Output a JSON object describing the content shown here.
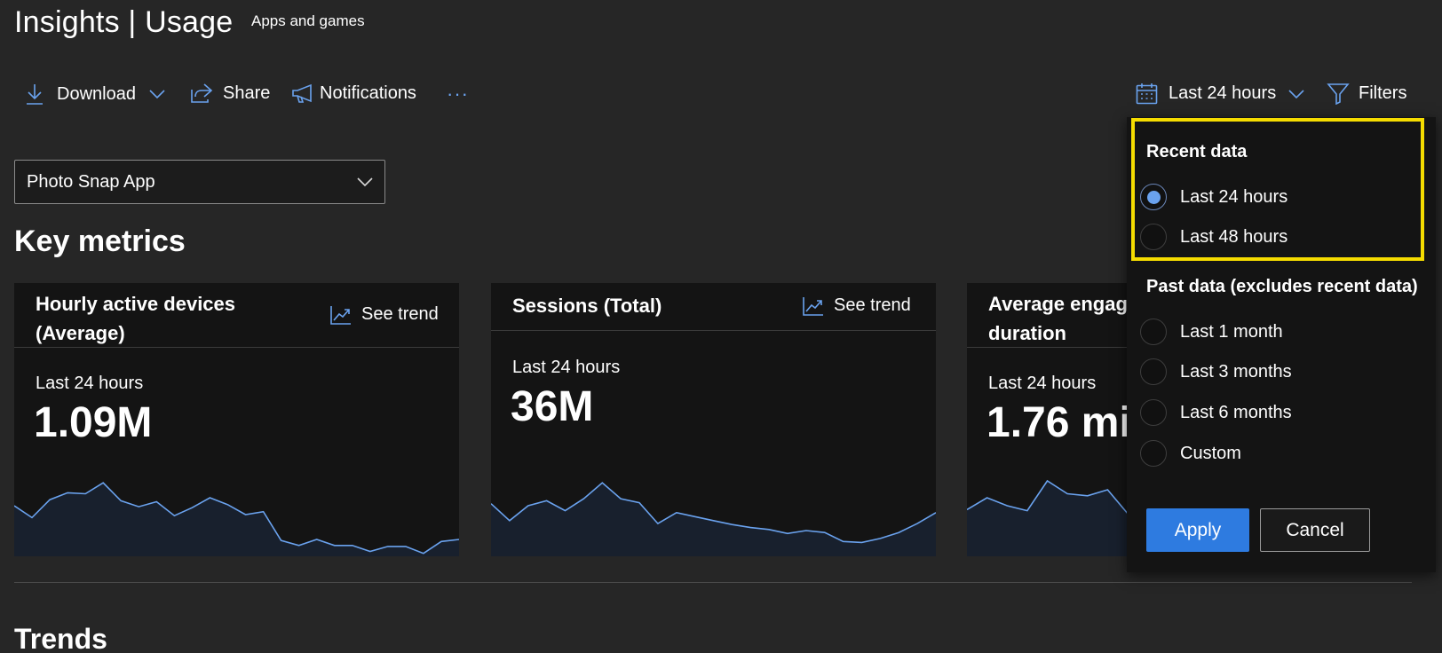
{
  "header": {
    "title": "Insights | Usage",
    "subtitle": "Apps and games"
  },
  "toolbar": {
    "download_label": "Download",
    "share_label": "Share",
    "notifications_label": "Notifications",
    "more_label": "···",
    "date_range_label": "Last 24 hours",
    "filters_label": "Filters"
  },
  "app_selector": {
    "selected": "Photo Snap App"
  },
  "key_metrics": {
    "heading": "Key metrics",
    "see_trend_label": "See trend",
    "cards": [
      {
        "title_line1": "Hourly active devices",
        "title_line2": "(Average)",
        "period": "Last 24 hours",
        "value": "1.09M",
        "sparkline": [
          0.58,
          0.7,
          0.52,
          0.45,
          0.46,
          0.35,
          0.53,
          0.59,
          0.54,
          0.68,
          0.6,
          0.5,
          0.57,
          0.67,
          0.64,
          0.93,
          0.98,
          0.92,
          0.98,
          0.98,
          1.04,
          0.99,
          0.99,
          1.06,
          0.94,
          0.92
        ]
      },
      {
        "title": "Sessions (Total)",
        "period": "Last 24 hours",
        "value": "36M",
        "sparkline": [
          0.56,
          0.73,
          0.58,
          0.53,
          0.63,
          0.51,
          0.35,
          0.51,
          0.55,
          0.76,
          0.65,
          0.69,
          0.73,
          0.77,
          0.8,
          0.82,
          0.86,
          0.83,
          0.85,
          0.94,
          0.95,
          0.91,
          0.85,
          0.76,
          0.65
        ]
      },
      {
        "title_line1": "Average engag",
        "title_line2": "duration",
        "period": "Last 24 hours",
        "value": "1.76 mi",
        "sparkline": [
          0.62,
          0.5,
          0.58,
          0.63,
          0.33,
          0.46,
          0.48,
          0.42,
          0.66
        ]
      }
    ]
  },
  "date_panel": {
    "recent_heading": "Recent data",
    "recent_options": [
      {
        "label": "Last 24 hours",
        "selected": true
      },
      {
        "label": "Last 48 hours",
        "selected": false
      }
    ],
    "past_heading": "Past data (excludes recent data)",
    "past_options": [
      {
        "label": "Last 1 month",
        "selected": false
      },
      {
        "label": "Last 3 months",
        "selected": false
      },
      {
        "label": "Last 6 months",
        "selected": false
      },
      {
        "label": "Custom",
        "selected": false
      }
    ],
    "apply_label": "Apply",
    "cancel_label": "Cancel"
  },
  "trends": {
    "heading": "Trends"
  },
  "colors": {
    "background": "#262626",
    "card": "#141414",
    "accent": "#6aa2ee",
    "primary_button": "#2e7be0",
    "highlight": "#f5dc00"
  }
}
